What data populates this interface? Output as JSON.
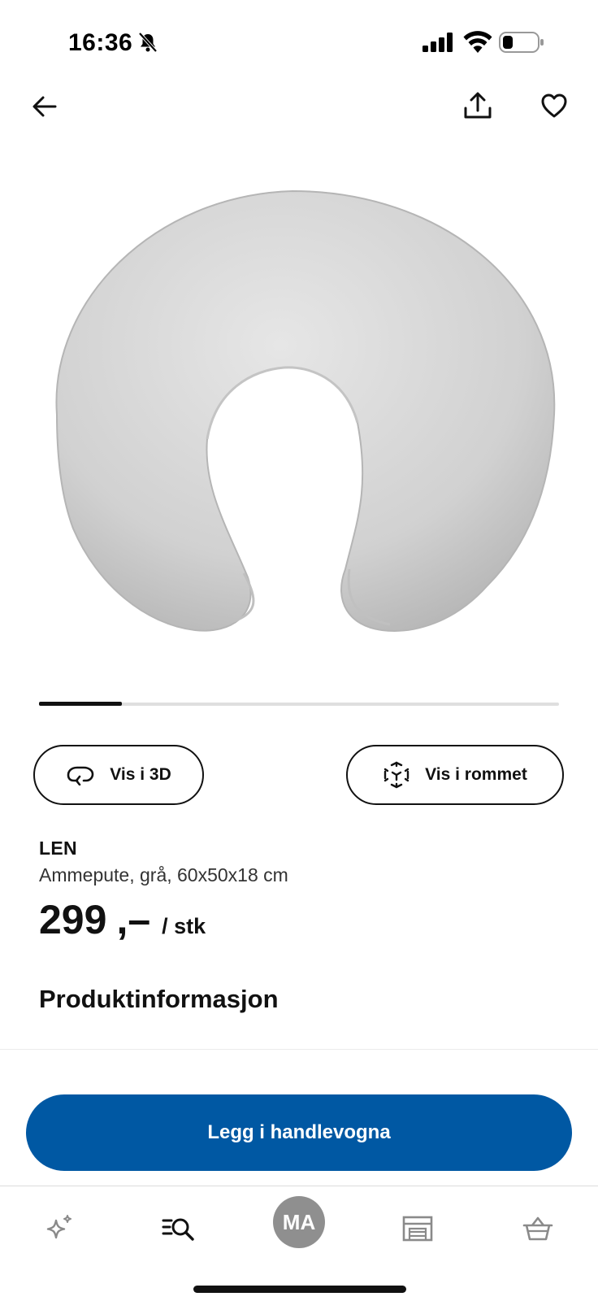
{
  "status_bar": {
    "time": "16:36",
    "icons": [
      "bell-slash-icon",
      "cellular-signal-icon",
      "wifi-icon",
      "battery-icon"
    ]
  },
  "header": {
    "icons": [
      "arrow-left-icon",
      "share-icon",
      "heart-icon"
    ]
  },
  "product_image": {
    "icon": "nursing-pillow-image"
  },
  "carousel": {
    "progress": 0.16
  },
  "actions": {
    "view_3d_label": "Vis i 3D",
    "view_room_label": "Vis i rommet"
  },
  "product": {
    "name": "LEN",
    "description": "Ammepute, grå, 60x50x18 cm",
    "price_amount": "299",
    "price_suffix": ",–",
    "price_unit": "/ stk"
  },
  "section": {
    "title": "Produktinformasjon"
  },
  "cart": {
    "label": "Legg i handlevogna"
  },
  "tab_bar": {
    "profile_initials": "MA",
    "icons": [
      "sparkle-icon",
      "search-list-icon",
      "profile-avatar",
      "store-icon",
      "basket-icon"
    ]
  },
  "colors": {
    "primary": "#0058a3",
    "avatar": "#8f8f8f",
    "text": "#111111"
  }
}
